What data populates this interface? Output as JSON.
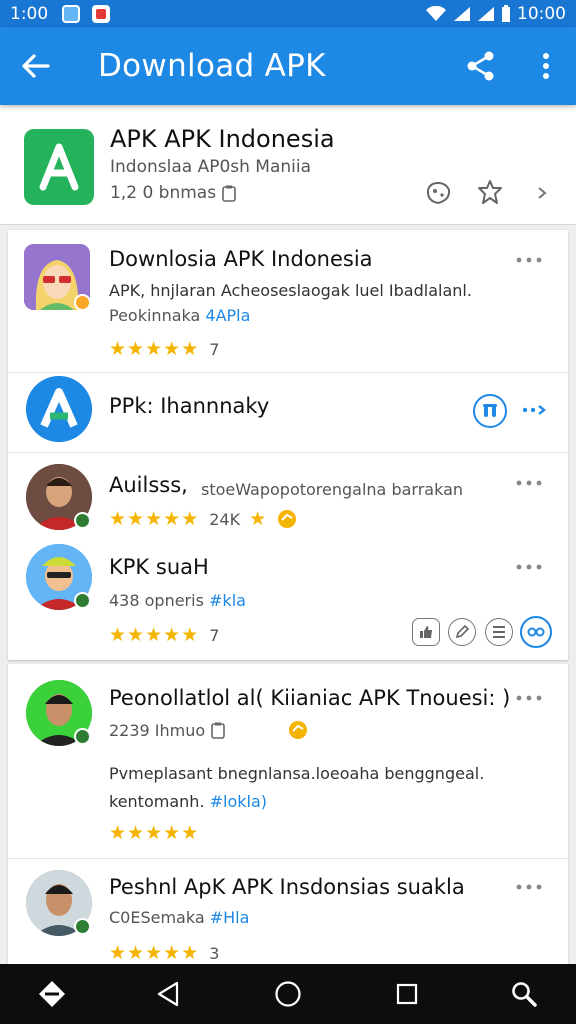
{
  "status_bar": {
    "time_left": "1:00",
    "time_right": "10:00"
  },
  "app_bar": {
    "title": "Download APK"
  },
  "header": {
    "title": "APK APK Indonesia",
    "subtitle": "Indonslaa AP0sh Maniia",
    "count": "1,2 0 bnmas"
  },
  "reviews": [
    {
      "name": "Downlosia APK Indonesia",
      "line1": "APK, hnjlaran Acheoseslaogak luel Ibadlalanl.",
      "line2_prefix": "Peokinnaka",
      "line2_link": "4APla",
      "rating": 5,
      "count": "7"
    },
    {
      "name": "PPk: Ihannnaky"
    },
    {
      "name": "Auilsss,",
      "inline": "stoeWapopotorengalna barrakan",
      "rating": 5,
      "count": "24K"
    },
    {
      "name": "KPK suaH",
      "line1_prefix": "438 opneris",
      "line1_link": "#kla",
      "rating": 5,
      "count": "7"
    },
    {
      "name": "Peonollatlol al( Kiianiac APK Tnouesi: )",
      "line1": "2239 Ihmuo",
      "body1": "Pvmeplasant bnegnlansa.loeoaha benggngeal.",
      "body2_prefix": "kentomanh.",
      "body2_link": "#lokla)",
      "rating": 5
    },
    {
      "name": "Peshnl ApK APK Insdonsias suakla",
      "line1": "C0ESemaka",
      "line1_link": "#Hla",
      "rating": 5,
      "count": "3"
    }
  ],
  "colors": {
    "primary": "#1e88e5",
    "status_bar": "#1976d2",
    "star": "#f5b400",
    "app_icon": "#24b25b"
  }
}
